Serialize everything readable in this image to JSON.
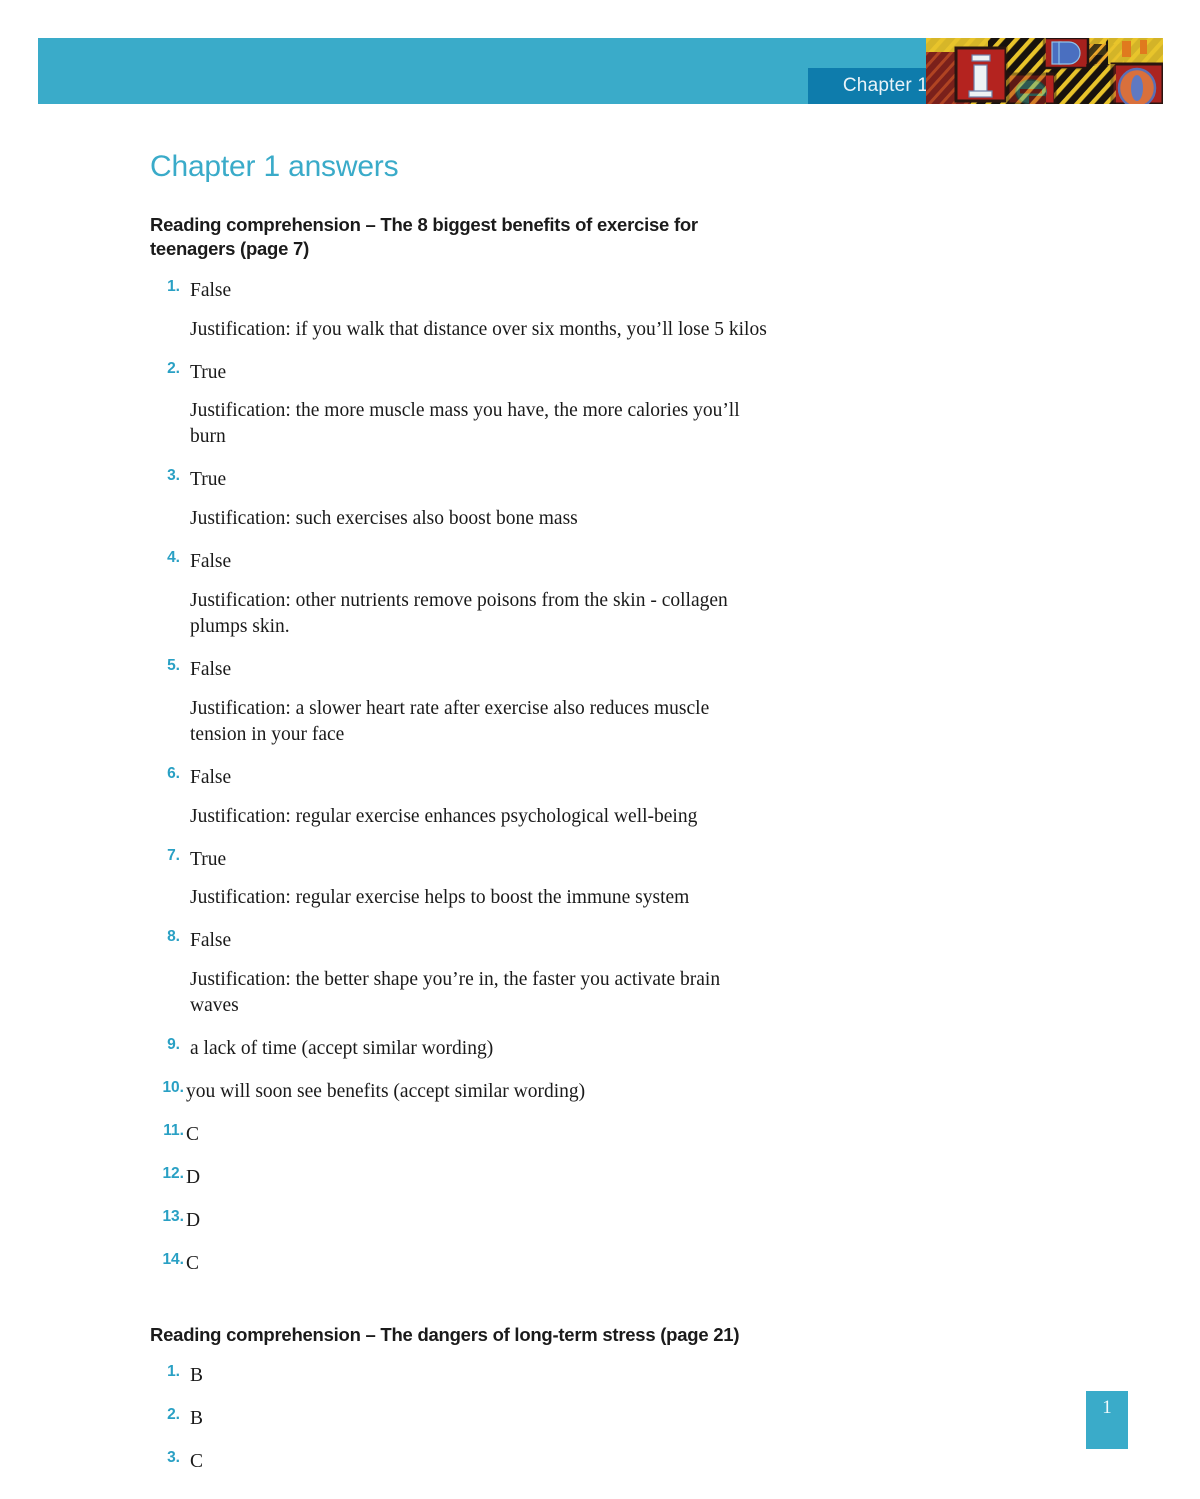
{
  "header": {
    "chapter_tab_label": "Chapter 1",
    "band_color": "#3AABC9",
    "tab_color": "#0E7CAC",
    "art_name": "graffiti-letter-blocks"
  },
  "document": {
    "page_title": "Chapter 1 answers",
    "title_color": "#3AABC9"
  },
  "sections": [
    {
      "heading": "Reading comprehension – The 8 biggest benefits of exercise for teenagers (page 7)",
      "items": [
        {
          "num": "1.",
          "answer": "False",
          "justification": "Justification: if you walk that distance over six months, you’ll lose 5 kilos"
        },
        {
          "num": "2.",
          "answer": "True",
          "justification": "Justification: the more muscle mass you have, the more calories you’ll burn"
        },
        {
          "num": "3.",
          "answer": "True",
          "justification": "Justification: such exercises also boost bone mass"
        },
        {
          "num": "4.",
          "answer": "False",
          "justification": "Justification: other nutrients remove poisons from the skin - collagen plumps skin."
        },
        {
          "num": "5.",
          "answer": "False",
          "justification": "Justification: a slower heart rate after exercise also reduces muscle tension in your face"
        },
        {
          "num": "6.",
          "answer": "False",
          "justification": "Justification: regular exercise enhances psychological well-being"
        },
        {
          "num": "7.",
          "answer": "True",
          "justification": "Justification: regular exercise helps to boost the immune system"
        },
        {
          "num": "8.",
          "answer": "False",
          "justification": "Justification: the better shape you’re in, the faster you activate brain waves"
        },
        {
          "num": "9.",
          "answer": "a lack of time (accept similar wording)",
          "justification": ""
        },
        {
          "num": "10.",
          "answer": "you will soon see benefits (accept similar wording)",
          "justification": ""
        },
        {
          "num": "11.",
          "answer": "C",
          "justification": ""
        },
        {
          "num": "12.",
          "answer": "D",
          "justification": ""
        },
        {
          "num": "13.",
          "answer": "D",
          "justification": ""
        },
        {
          "num": "14.",
          "answer": "C",
          "justification": ""
        }
      ]
    },
    {
      "heading": "Reading comprehension – The dangers of long-term stress (page 21)",
      "items": [
        {
          "num": "1.",
          "answer": "B",
          "justification": ""
        },
        {
          "num": "2.",
          "answer": "B",
          "justification": ""
        },
        {
          "num": "3.",
          "answer": "C",
          "justification": ""
        }
      ]
    }
  ],
  "footer": {
    "page_number": "1",
    "box_color": "#3AABC9"
  }
}
